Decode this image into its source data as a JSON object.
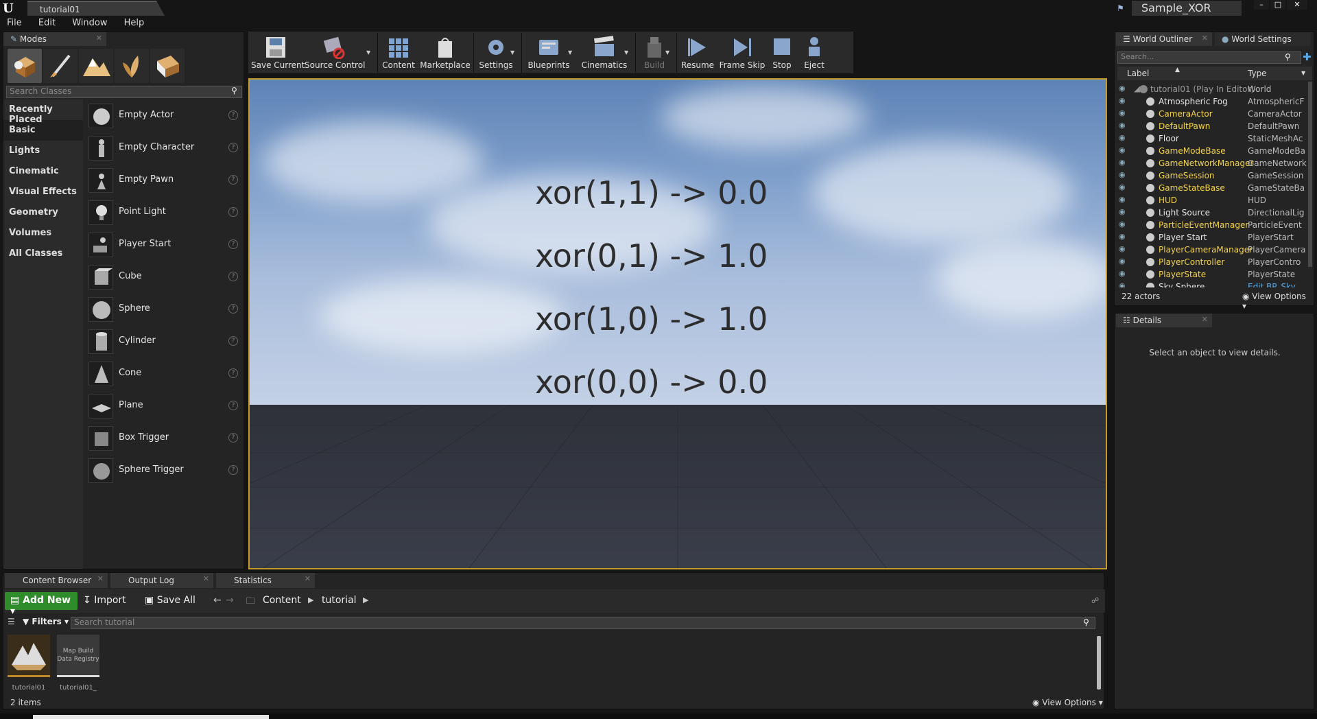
{
  "titlebar": {
    "doc_tab": "tutorial01",
    "project": "Sample_XOR",
    "min": "–",
    "max": "□",
    "close": "✕"
  },
  "menu": [
    "File",
    "Edit",
    "Window",
    "Help"
  ],
  "modes": {
    "tab": "Modes",
    "search_placeholder": "Search Classes",
    "categories": [
      "Recently Placed",
      "Basic",
      "Lights",
      "Cinematic",
      "Visual Effects",
      "Geometry",
      "Volumes",
      "All Classes"
    ],
    "items": [
      "Empty Actor",
      "Empty Character",
      "Empty Pawn",
      "Point Light",
      "Player Start",
      "Cube",
      "Sphere",
      "Cylinder",
      "Cone",
      "Plane",
      "Box Trigger",
      "Sphere Trigger"
    ]
  },
  "toolbar": {
    "save_current": "Save Current",
    "source_control": "Source Control",
    "content": "Content",
    "marketplace": "Marketplace",
    "settings": "Settings",
    "blueprints": "Blueprints",
    "cinematics": "Cinematics",
    "build": "Build",
    "resume": "Resume",
    "frame_skip": "Frame Skip",
    "stop": "Stop",
    "eject": "Eject"
  },
  "viewport": {
    "lines": [
      "xor(1,1) -> 0.0",
      "xor(0,1) -> 1.0",
      "xor(1,0) -> 1.0",
      "xor(0,0) -> 0.0"
    ]
  },
  "outliner": {
    "tab": "World Outliner",
    "settings_tab": "World Settings",
    "search_placeholder": "Search...",
    "col_label": "Label",
    "col_type": "Type",
    "rows": [
      {
        "label": "tutorial01 (Play In Editor)",
        "type": "World"
      },
      {
        "label": "Atmospheric Fog",
        "type": "AtmosphericF"
      },
      {
        "label": "CameraActor",
        "type": "CameraActor"
      },
      {
        "label": "DefaultPawn",
        "type": "DefaultPawn"
      },
      {
        "label": "Floor",
        "type": "StaticMeshAc"
      },
      {
        "label": "GameModeBase",
        "type": "GameModeBa"
      },
      {
        "label": "GameNetworkManager",
        "type": "GameNetwork"
      },
      {
        "label": "GameSession",
        "type": "GameSession"
      },
      {
        "label": "GameStateBase",
        "type": "GameStateBa"
      },
      {
        "label": "HUD",
        "type": "HUD"
      },
      {
        "label": "Light Source",
        "type": "DirectionalLig"
      },
      {
        "label": "ParticleEventManager",
        "type": "ParticleEvent"
      },
      {
        "label": "Player Start",
        "type": "PlayerStart"
      },
      {
        "label": "PlayerCameraManager",
        "type": "PlayerCamera"
      },
      {
        "label": "PlayerController",
        "type": "PlayerContro"
      },
      {
        "label": "PlayerState",
        "type": "PlayerState"
      },
      {
        "label": "Sky Sphere",
        "type": "Edit BP_Sky"
      }
    ],
    "count": "22 actors",
    "view_options": "View Options"
  },
  "details": {
    "tab": "Details",
    "message": "Select an object to view details."
  },
  "content_browser": {
    "tabs": [
      "Content Browser",
      "Output Log",
      "Statistics"
    ],
    "add_new": "Add New",
    "import": "Import",
    "save_all": "Save All",
    "path": [
      "Content",
      "tutorial"
    ],
    "filters": "Filters",
    "search_placeholder": "Search tutorial",
    "assets": [
      {
        "name": "tutorial01",
        "thumb_text": ""
      },
      {
        "name": "tutorial01_",
        "thumb_text": "Map Build Data Registry"
      }
    ],
    "count": "2 items",
    "view_options": "View Options"
  },
  "colors": {
    "accent_selected": "#c49a2c",
    "add_new": "#2e8c2a",
    "highlight_actor": "#f3d24a"
  }
}
